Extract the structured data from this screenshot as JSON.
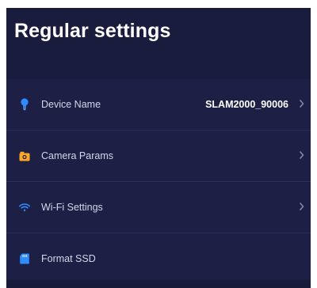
{
  "header": {
    "title": "Regular settings"
  },
  "settings": {
    "items": [
      {
        "label": "Device Name",
        "value": "SLAM2000_90006",
        "icon": "bulb-icon",
        "has_chevron": true
      },
      {
        "label": "Camera Params",
        "value": "",
        "icon": "camera-icon",
        "has_chevron": true
      },
      {
        "label": "Wi-Fi Settings",
        "value": "",
        "icon": "wifi-icon",
        "has_chevron": true
      },
      {
        "label": "Format SSD",
        "value": "",
        "icon": "sd-card-icon",
        "has_chevron": false
      }
    ]
  },
  "colors": {
    "background": "#1d1f44",
    "header_bg": "#1a1c3e",
    "bulb": "#2f8cff",
    "camera": "#ffa726",
    "wifi": "#2f8cff",
    "sd_card": "#2f8cff"
  }
}
